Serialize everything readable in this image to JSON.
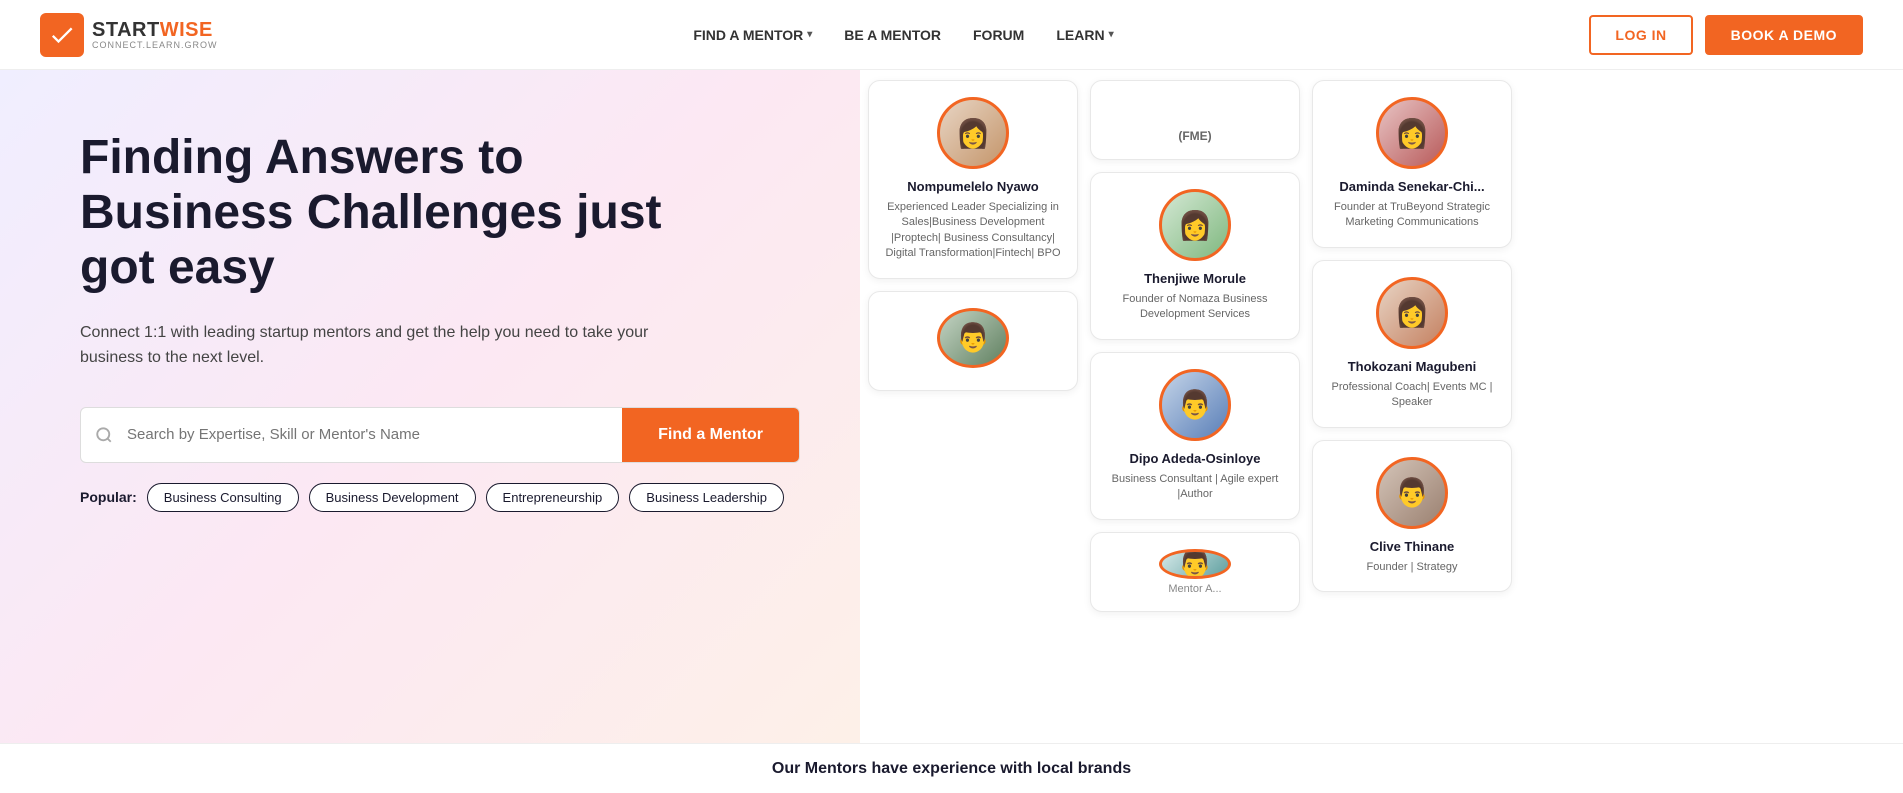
{
  "header": {
    "logo_start": "START",
    "logo_wise": "WISE",
    "logo_tagline": "CONNECT.LEARN.GROW",
    "nav": [
      {
        "label": "FIND A MENTOR",
        "has_dropdown": true
      },
      {
        "label": "BE A MENTOR",
        "has_dropdown": false
      },
      {
        "label": "FORUM",
        "has_dropdown": false
      },
      {
        "label": "LEARN",
        "has_dropdown": true
      }
    ],
    "login_label": "LOG IN",
    "book_label": "BOOK A DEMO"
  },
  "hero": {
    "title": "Finding Answers to Business Challenges just got easy",
    "subtitle_prefix": "Connect 1:1 with leading startup mentors and get the help you need to take your business to the next level.",
    "search_placeholder": "Search by Expertise, Skill or Mentor's Name",
    "search_btn": "Find a Mentor",
    "popular_label": "Popular:",
    "tags": [
      "Business Consulting",
      "Business Development",
      "Entrepreneurship",
      "Business Leadership"
    ]
  },
  "mentors": {
    "col1": [
      {
        "name": "Nompumelelo Nyawo",
        "desc": "Experienced Leader Specializing in Sales|Business Development |Proptech| Business Consultancy| Digital Transformation|Fintech| BPO",
        "avatar_emoji": "👩",
        "avatar_class": "av-nyawo"
      },
      {
        "name": "",
        "desc": "",
        "avatar_emoji": "👨",
        "avatar_class": "av-bottom1",
        "partial": true
      }
    ],
    "col2": [
      {
        "name": "(FME)",
        "desc": "",
        "avatar_emoji": "",
        "avatar_class": "av-morule",
        "partial_top": true
      },
      {
        "name": "Thenjiwe Morule",
        "desc": "Founder of Nomaza Business Development Services",
        "avatar_emoji": "👩",
        "avatar_class": "av-morule"
      },
      {
        "name": "Dipo Adeda-Osinloye",
        "desc": "Business Consultant | Agile expert |Author",
        "avatar_emoji": "👨",
        "avatar_class": "av-dipo"
      },
      {
        "name": "",
        "desc": "",
        "avatar_emoji": "👨",
        "avatar_class": "av-bottom2",
        "partial": true
      }
    ],
    "col3": [
      {
        "name": "Daminda Senekar-Chi...",
        "desc": "Founder at TruBeyond Strategic Marketing Communications",
        "avatar_emoji": "👩",
        "avatar_class": "av-daminda"
      },
      {
        "name": "Thokozani Magubeni",
        "desc": "Professional Coach| Events MC | Speaker",
        "avatar_emoji": "👩",
        "avatar_class": "av-thokozani"
      },
      {
        "name": "Clive Thinane",
        "desc": "Founder | Strategy",
        "avatar_emoji": "👨",
        "avatar_class": "av-clive"
      }
    ]
  },
  "bottom_banner": {
    "text": "Our Mentors have experience with local brands"
  }
}
